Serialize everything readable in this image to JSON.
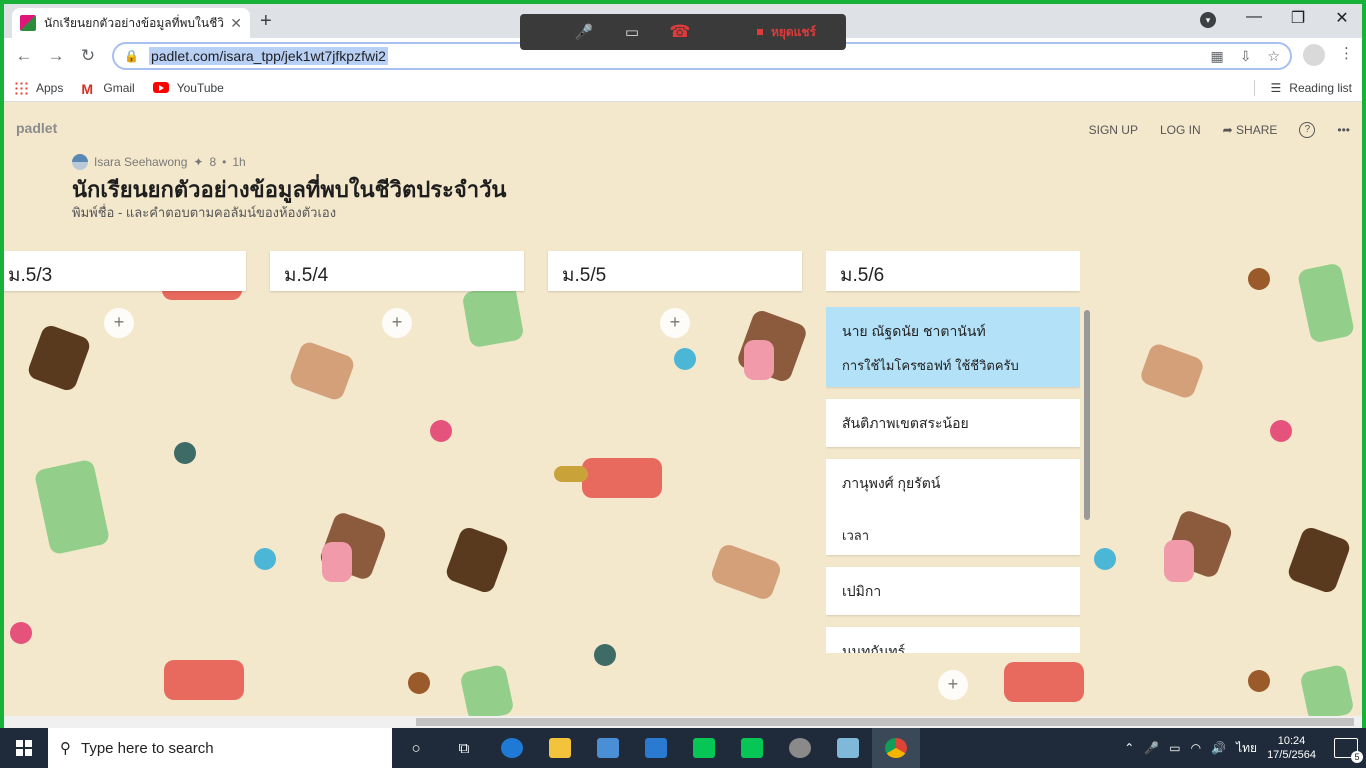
{
  "browser": {
    "tab_title": "นักเรียนยกตัวอย่างข้อมูลที่พบในชีวิตประจำวัน",
    "url": "padlet.com/isara_tpp/jek1wt7jfkpzfwi2",
    "bookmarks": [
      "Apps",
      "Gmail",
      "YouTube"
    ],
    "reading_list": "Reading list"
  },
  "meeting_bar": {
    "stop_share": "หยุดแชร์"
  },
  "padlet": {
    "logo": "padlet",
    "sign_up": "SIGN UP",
    "log_in": "LOG IN",
    "share": "SHARE",
    "author": "Isara Seehawong",
    "likes": "8",
    "time": "1h",
    "title": "นักเรียนยกตัวอย่างข้อมูลที่พบในชีวิตประจำวัน",
    "subtitle": "พิมพ์ชื่อ - และคำตอบตามคอลัมน์ของห้องตัวเอง",
    "columns": [
      {
        "title": "ม.5/3"
      },
      {
        "title": "ม.5/4"
      },
      {
        "title": "ม.5/5"
      },
      {
        "title": "ม.5/6"
      }
    ],
    "cards": [
      {
        "title": "นาย ณัฐดนัย ชาตานันท์",
        "body": "การใช้ไมโครซอฟท์ ใช้ชีวิตครับ"
      },
      {
        "title": "สันติภาพเขตสระน้อย",
        "body": ""
      },
      {
        "title": "ภานุพงศ์ กุยรัตน์",
        "body": "เวลา"
      },
      {
        "title": "เปมิกา",
        "body": ""
      },
      {
        "title": "นนทกันทร์",
        "body": ""
      }
    ]
  },
  "taskbar": {
    "search_placeholder": "Type here to search",
    "lang": "ไทย",
    "time": "10:24",
    "date": "17/5/2564",
    "notifications": "5"
  },
  "colors": {
    "padlet_bg": "#f4e8cc",
    "card_highlight": "#b3e1f7",
    "frame": "#18b23a",
    "taskbar": "#1f2b3a"
  }
}
